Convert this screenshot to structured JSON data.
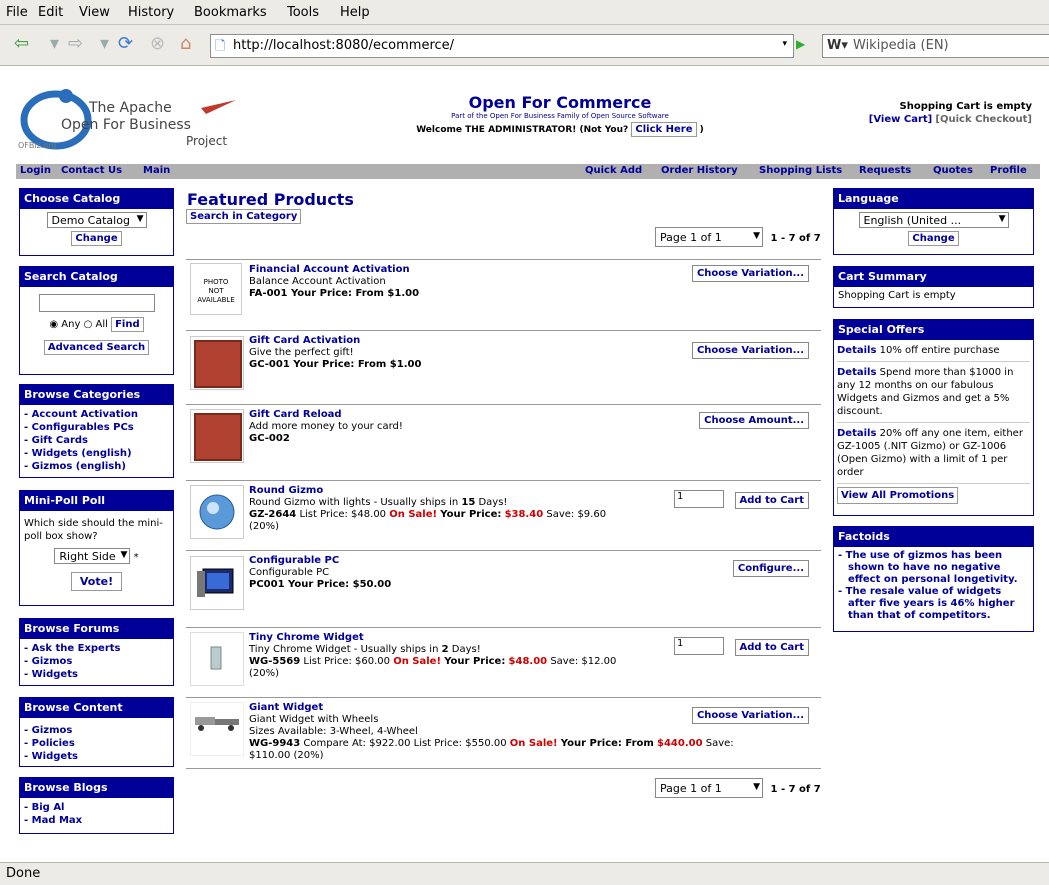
{
  "browser": {
    "menu": [
      "File",
      "Edit",
      "View",
      "History",
      "Bookmarks",
      "Tools",
      "Help"
    ],
    "url": "http://localhost:8080/ecommerce/",
    "search_placeholder": "Wikipedia (EN)",
    "status": "Done"
  },
  "header": {
    "logo_line1": "The Apache",
    "logo_line2": "Open For Business",
    "logo_line3": "Project",
    "logo_sub": "OFBiz.org",
    "title": "Open For Commerce",
    "subtitle": "Part of the Open For Business Family of Open Source Software",
    "welcome": "Welcome THE ADMINISTRATOR! (Not You?",
    "click_here": "Click Here",
    "paren_close": ")",
    "cart_status": "Shopping Cart is empty",
    "view_cart": "[View Cart]",
    "quick_checkout": "[Quick Checkout]"
  },
  "appbar": {
    "login": "Login",
    "contact_us": "Contact Us",
    "main": "Main",
    "quick_add": "Quick Add",
    "order_history": "Order History",
    "shopping_lists": "Shopping Lists",
    "requests": "Requests",
    "quotes": "Quotes",
    "profile": "Profile"
  },
  "left": {
    "choose_catalog": {
      "title": "Choose Catalog",
      "selected": "Demo Catalog",
      "button": "Change"
    },
    "search_catalog": {
      "title": "Search Catalog",
      "any": "Any",
      "all": "All",
      "find": "Find",
      "advanced": "Advanced Search"
    },
    "browse_categories": {
      "title": "Browse Categories",
      "items": [
        "- Account Activation",
        "- Configurables PCs",
        "- Gift Cards",
        "- Widgets (english)",
        "- Gizmos (english)"
      ]
    },
    "mini_poll": {
      "title": "Mini-Poll Poll",
      "question": "Which side should the mini-poll box show?",
      "selected": "Right Side",
      "required": "*",
      "button": "Vote!"
    },
    "browse_forums": {
      "title": "Browse Forums",
      "items": [
        "- Ask the Experts",
        "- Gizmos",
        "- Widgets"
      ]
    },
    "browse_content": {
      "title": "Browse Content",
      "items": [
        "- Gizmos",
        "- Policies",
        "- Widgets"
      ]
    },
    "browse_blogs": {
      "title": "Browse Blogs",
      "items": [
        "- Big Al",
        "- Mad Max"
      ]
    }
  },
  "main": {
    "title": "Featured Products",
    "search_in_category": "Search in Category",
    "page_select": "Page 1 of 1",
    "range": "1 - 7 of 7",
    "products": [
      {
        "name": "Financial Account Activation",
        "desc": "Balance Account Activation",
        "code": "FA-001",
        "price_line": "Your Price: From $1.00",
        "button": "Choose Variation..."
      },
      {
        "name": "Gift Card Activation",
        "desc": "Give the perfect gift!",
        "code": "GC-001",
        "price_line": "Your Price: From $1.00",
        "button": "Choose Variation..."
      },
      {
        "name": "Gift Card Reload",
        "desc": "Add more money to your card!",
        "code": "GC-002",
        "button": "Choose Amount..."
      },
      {
        "name": "Round Gizmo",
        "desc_pre": "Round Gizmo with lights - Usually ships in ",
        "desc_days": "15",
        "desc_post": " Days!",
        "code": "GZ-2644",
        "list_price": "List Price: $48.00",
        "on_sale": "On Sale!",
        "your_price_label": "Your Price:",
        "your_price": "$38.40",
        "save": "Save: $9.60",
        "save_pct": "(20%)",
        "qty": "1",
        "button": "Add to Cart"
      },
      {
        "name": "Configurable PC",
        "desc": "Configurable PC",
        "code": "PC001",
        "price_line": "Your Price: $50.00",
        "button": "Configure..."
      },
      {
        "name": "Tiny Chrome Widget",
        "desc_pre": "Tiny Chrome Widget - Usually ships in ",
        "desc_days": "2",
        "desc_post": " Days!",
        "code": "WG-5569",
        "list_price": "List Price: $60.00",
        "on_sale": "On Sale!",
        "your_price_label": "Your Price:",
        "your_price": "$48.00",
        "save": "Save: $12.00",
        "save_pct": "(20%)",
        "qty": "1",
        "button": "Add to Cart"
      },
      {
        "name": "Giant Widget",
        "desc": "Giant Widget with Wheels",
        "sizes": "Sizes Available: 3-Wheel, 4-Wheel",
        "code": "WG-9943",
        "compare": "Compare At: $922.00 List Price: $550.00",
        "on_sale": "On Sale!",
        "your_price_label": "Your Price: From",
        "your_price": "$440.00",
        "save": "Save:",
        "save2": "$110.00 (20%)",
        "button": "Choose Variation..."
      }
    ],
    "photo_na": [
      "PHOTO",
      "NOT",
      "AVAILABLE"
    ]
  },
  "right": {
    "language": {
      "title": "Language",
      "selected": "English (United ...",
      "button": "Change"
    },
    "cart_summary": {
      "title": "Cart Summary",
      "text": "Shopping Cart is empty"
    },
    "special_offers": {
      "title": "Special Offers",
      "details": "Details",
      "offers": [
        " 10% off entire purchase",
        " Spend more than $1000 in any 12 months on our fabulous Widgets and Gizmos and get a 5% discount.",
        " 20% off any one item, either GZ-1005 (.NIT Gizmo) or GZ-1006 (Open Gizmo) with a limit of 1 per order"
      ],
      "button": "View All Promotions"
    },
    "factoids": {
      "title": "Factoids",
      "items": [
        "The use of gizmos has been shown to have no negative effect on personal longetivity.",
        "The resale value of widgets after five years is 46% higher than that of competitors."
      ]
    }
  }
}
